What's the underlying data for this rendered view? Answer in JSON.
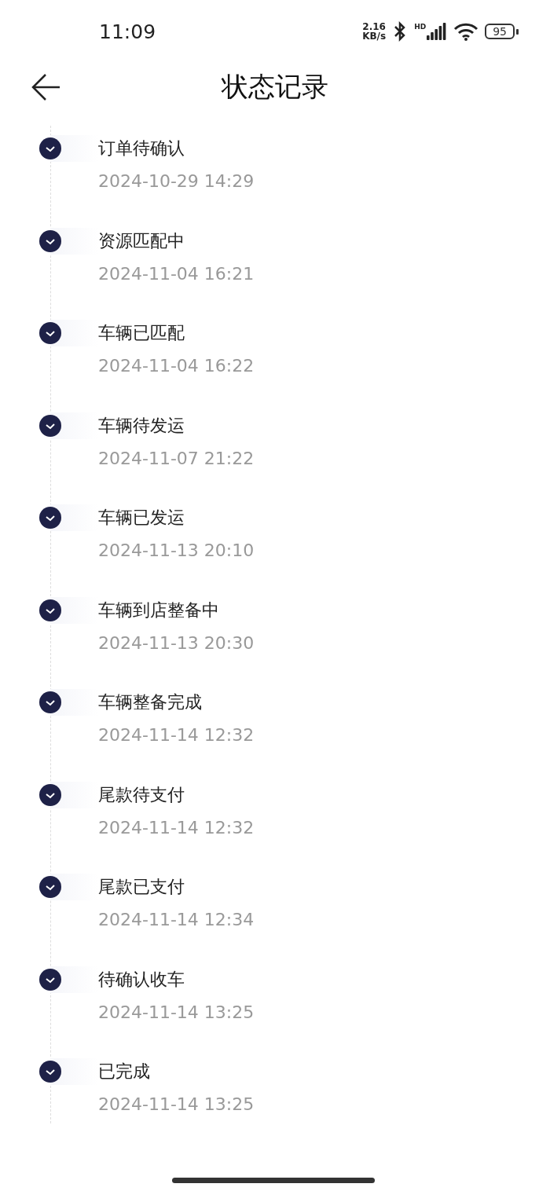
{
  "status_bar": {
    "time": "11:09",
    "speed_value": "2.16",
    "speed_unit": "KB/s",
    "signal_label": "HD",
    "battery": "95"
  },
  "header": {
    "title": "状态记录"
  },
  "timeline": [
    {
      "title": "订单待确认",
      "time": "2024-10-29 14:29"
    },
    {
      "title": "资源匹配中",
      "time": "2024-11-04 16:21"
    },
    {
      "title": "车辆已匹配",
      "time": "2024-11-04 16:22"
    },
    {
      "title": "车辆待发运",
      "time": "2024-11-07 21:22"
    },
    {
      "title": "车辆已发运",
      "time": "2024-11-13 20:10"
    },
    {
      "title": "车辆到店整备中",
      "time": "2024-11-13 20:30"
    },
    {
      "title": "车辆整备完成",
      "time": "2024-11-14 12:32"
    },
    {
      "title": "尾款待支付",
      "time": "2024-11-14 12:32"
    },
    {
      "title": "尾款已支付",
      "time": "2024-11-14 12:34"
    },
    {
      "title": "待确认收车",
      "time": "2024-11-14 13:25"
    },
    {
      "title": "已完成",
      "time": "2024-11-14 13:25"
    }
  ]
}
